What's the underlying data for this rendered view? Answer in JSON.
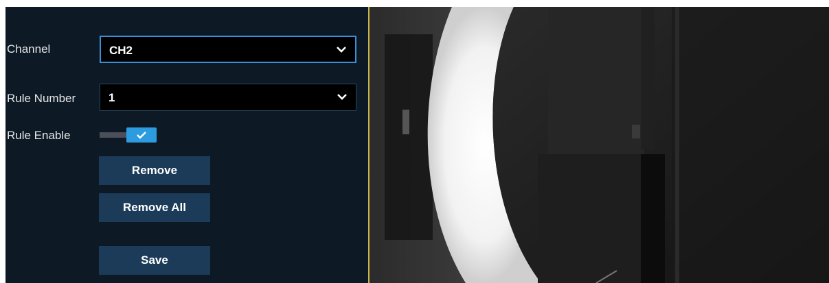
{
  "form": {
    "channel_label": "Channel",
    "channel_value": "CH2",
    "rule_number_label": "Rule Number",
    "rule_number_value": "1",
    "rule_enable_label": "Rule Enable",
    "rule_enable_checked": true
  },
  "buttons": {
    "remove_label": "Remove",
    "remove_all_label": "Remove All",
    "save_label": "Save"
  },
  "icons": {
    "dropdown": "chevron-down-icon",
    "toggle": "check-icon"
  },
  "colors": {
    "panel_bg": "#0d1a26",
    "button_bg": "#1b3b59",
    "accent": "#2c9be0",
    "focus_border": "#3a8fd6"
  }
}
